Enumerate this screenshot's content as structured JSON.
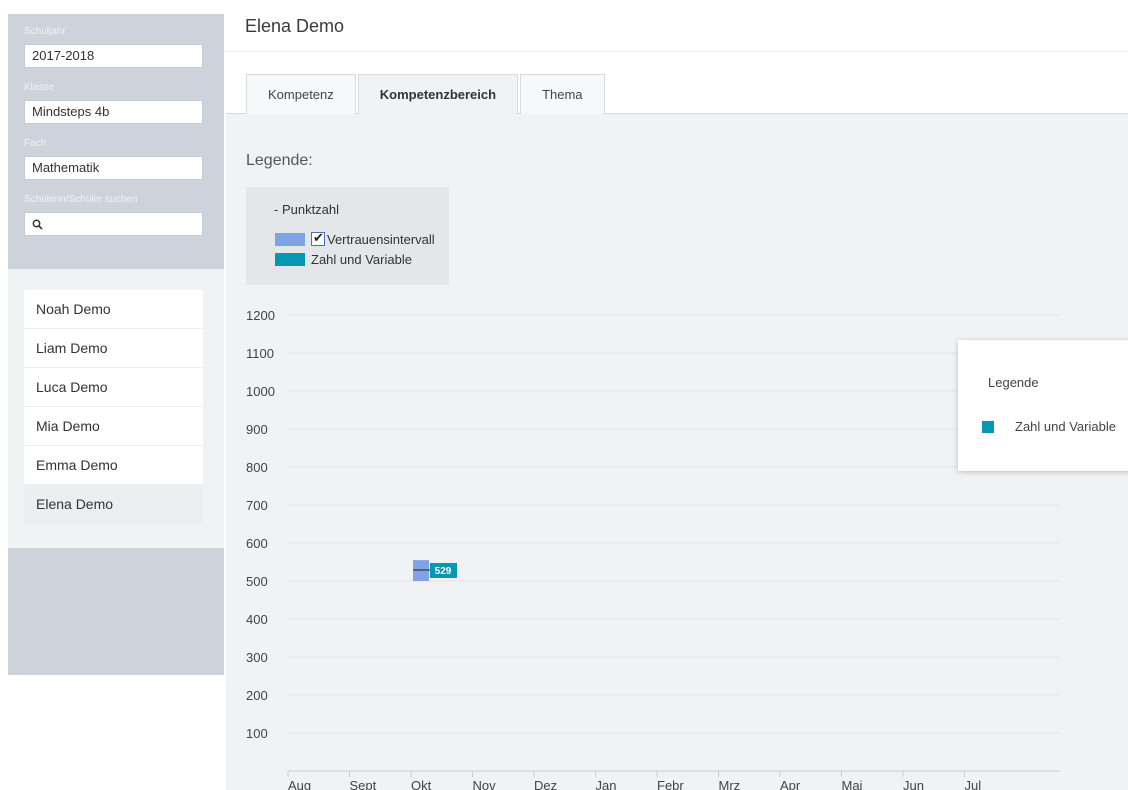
{
  "sidebar": {
    "filters": [
      {
        "label": "Schuljahr",
        "value": "2017-2018"
      },
      {
        "label": "Klasse",
        "value": "Mindsteps 4b"
      },
      {
        "label": "Fach",
        "value": "Mathematik"
      }
    ],
    "search_label": "Schülerin/Schüler suchen",
    "search_icon": "search-icon",
    "students": [
      "Noah Demo",
      "Liam Demo",
      "Luca Demo",
      "Mia Demo",
      "Emma Demo",
      "Elena Demo"
    ],
    "active_student": "Elena Demo"
  },
  "main": {
    "title": "Elena Demo",
    "tabs": [
      {
        "label": "Kompetenz",
        "active": false
      },
      {
        "label": "Kompetenzbereich",
        "active": true
      },
      {
        "label": "Thema",
        "active": false
      }
    ],
    "legend_title": "Legende:",
    "legend": {
      "heading": "- Punktzahl",
      "confidence_label": "Vertrauensintervall",
      "confidence_checked": true,
      "series_label": "Zahl und Variable"
    },
    "float_legend": {
      "title": "Legende",
      "item": "Zahl und Variable"
    }
  },
  "colors": {
    "confidence": "#7fa3e3",
    "series": "#0697b3",
    "sidebar": "#cdd2db",
    "content_bg": "#f0f2f4"
  },
  "chart_data": {
    "type": "scatter",
    "categories": [
      "Aug",
      "Sept",
      "Okt",
      "Nov",
      "Dez",
      "Jan",
      "Febr",
      "Mrz",
      "Apr",
      "Mai",
      "Jun",
      "Jul"
    ],
    "y_ticks": [
      100,
      200,
      300,
      400,
      500,
      600,
      700,
      800,
      900,
      1000,
      1100,
      1200
    ],
    "ylim": [
      0,
      1200
    ],
    "grid": true,
    "series": [
      {
        "name": "Zahl und Variable",
        "points": [
          {
            "x": "Okt",
            "y": 529,
            "label": "529",
            "ci": [
              500,
              555
            ]
          }
        ]
      }
    ]
  }
}
